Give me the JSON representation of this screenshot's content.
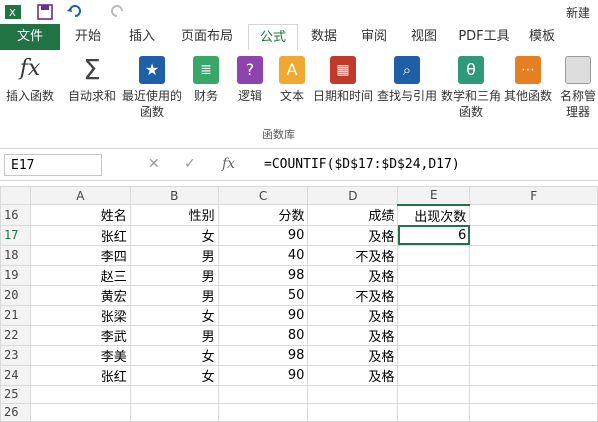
{
  "titlebar": {
    "title": "新建"
  },
  "tabs": {
    "file": "文件",
    "items": [
      "开始",
      "插入",
      "页面布局",
      "公式",
      "数据",
      "审阅",
      "视图",
      "PDF工具",
      "模板"
    ],
    "active_index": 3
  },
  "ribbon": {
    "buttons": [
      {
        "label": "插入函数",
        "icon": "fx-icon"
      },
      {
        "label": "自动求和",
        "icon": "sigma-icon"
      },
      {
        "label": "最近使用的函数",
        "icon": "star-book-icon"
      },
      {
        "label": "财务",
        "icon": "coins-book-icon"
      },
      {
        "label": "逻辑",
        "icon": "question-book-icon"
      },
      {
        "label": "文本",
        "icon": "letter-a-book-icon"
      },
      {
        "label": "日期和时间",
        "icon": "calendar-book-icon"
      },
      {
        "label": "查找与引用",
        "icon": "magnifier-book-icon"
      },
      {
        "label": "数学和三角函数",
        "icon": "theta-book-icon"
      },
      {
        "label": "其他函数",
        "icon": "more-book-icon"
      },
      {
        "label": "名称管理器",
        "icon": "name-manager-icon"
      }
    ],
    "group_label": "函数库"
  },
  "formula_bar": {
    "name_box": "E17",
    "formula": "=COUNTIF($D$17:$D$24,D17)",
    "cancel": "✕",
    "confirm": "✓",
    "fx": "fx"
  },
  "columns": [
    "A",
    "B",
    "C",
    "D",
    "E",
    "F"
  ],
  "rows": [
    {
      "num": "16",
      "a": "姓名",
      "b": "性别",
      "c": "分数",
      "d": "成绩",
      "e": "出现次数"
    },
    {
      "num": "17",
      "a": "张红",
      "b": "女",
      "c": "90",
      "d": "及格",
      "e": "6"
    },
    {
      "num": "18",
      "a": "李四",
      "b": "男",
      "c": "40",
      "d": "不及格",
      "e": ""
    },
    {
      "num": "19",
      "a": "赵三",
      "b": "男",
      "c": "98",
      "d": "及格",
      "e": ""
    },
    {
      "num": "20",
      "a": "黄宏",
      "b": "男",
      "c": "50",
      "d": "不及格",
      "e": ""
    },
    {
      "num": "21",
      "a": "张梁",
      "b": "女",
      "c": "90",
      "d": "及格",
      "e": ""
    },
    {
      "num": "22",
      "a": "李武",
      "b": "男",
      "c": "80",
      "d": "及格",
      "e": ""
    },
    {
      "num": "23",
      "a": "李美",
      "b": "女",
      "c": "98",
      "d": "及格",
      "e": ""
    },
    {
      "num": "24",
      "a": "张红",
      "b": "女",
      "c": "90",
      "d": "及格",
      "e": ""
    },
    {
      "num": "25",
      "a": "",
      "b": "",
      "c": "",
      "d": "",
      "e": ""
    },
    {
      "num": "26",
      "a": "",
      "b": "",
      "c": "",
      "d": "",
      "e": ""
    }
  ],
  "colors": {
    "accent": "#217346"
  }
}
